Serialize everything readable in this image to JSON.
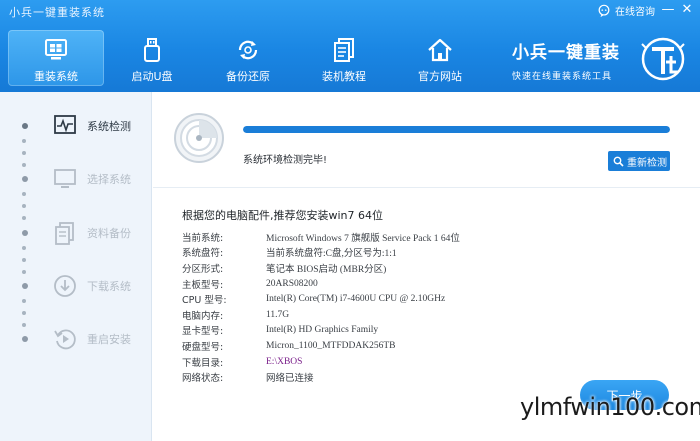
{
  "window": {
    "title": "小兵一键重装系统",
    "consult_label": "在线咨询",
    "minimize_glyph": "—",
    "close_glyph": "✕"
  },
  "nav": {
    "items": [
      {
        "label": "重装系统",
        "icon": "monitor-icon",
        "active": true
      },
      {
        "label": "启动U盘",
        "icon": "usb-icon",
        "active": false
      },
      {
        "label": "备份还原",
        "icon": "refresh-icon",
        "active": false
      },
      {
        "label": "装机教程",
        "icon": "book-icon",
        "active": false
      },
      {
        "label": "官方网站",
        "icon": "home-icon",
        "active": false
      }
    ]
  },
  "brand": {
    "name": "小兵一键重装",
    "slogan": "快速在线重装系统工具"
  },
  "steps": [
    {
      "label": "系统检测",
      "icon": "pulse-monitor-icon",
      "active": true
    },
    {
      "label": "选择系统",
      "icon": "desktop-icon",
      "active": false
    },
    {
      "label": "资料备份",
      "icon": "document-icon",
      "active": false
    },
    {
      "label": "下载系统",
      "icon": "download-icon",
      "active": false
    },
    {
      "label": "重启安装",
      "icon": "restart-icon",
      "active": false
    }
  ],
  "check": {
    "progress": 1.0,
    "status": "系统环境检测完毕!",
    "recheck_label": "重新检测"
  },
  "info": {
    "heading": "根据您的电脑配件,推荐您安装win7 64位",
    "rows": [
      {
        "key": "当前系统:",
        "value": "Microsoft Windows 7 旗舰版 Service Pack 1 64位"
      },
      {
        "key": "系统盘符:",
        "value": "当前系统盘符:C盘,分区号为:1:1"
      },
      {
        "key": "分区形式:",
        "value": "笔记本 BIOS启动 (MBR分区)"
      },
      {
        "key": "主板型号:",
        "value": "20ARS08200"
      },
      {
        "key": "CPU 型号:",
        "value": "Intel(R) Core(TM) i7-4600U CPU @ 2.10GHz"
      },
      {
        "key": "电脑内存:",
        "value": "11.7G"
      },
      {
        "key": "显卡型号:",
        "value": "Intel(R) HD Graphics Family"
      },
      {
        "key": "硬盘型号:",
        "value": "Micron_1100_MTFDDAK256TB"
      },
      {
        "key": "下载目录:",
        "value": "E:\\XBOS",
        "highlight": "#7a1f8a"
      },
      {
        "key": "网络状态:",
        "value": "网络已连接"
      }
    ]
  },
  "next_label": "下一步",
  "watermark": "ylmfwin100.com",
  "colors": {
    "header_blue": "#1a86e3",
    "accent": "#1a7ed8"
  }
}
